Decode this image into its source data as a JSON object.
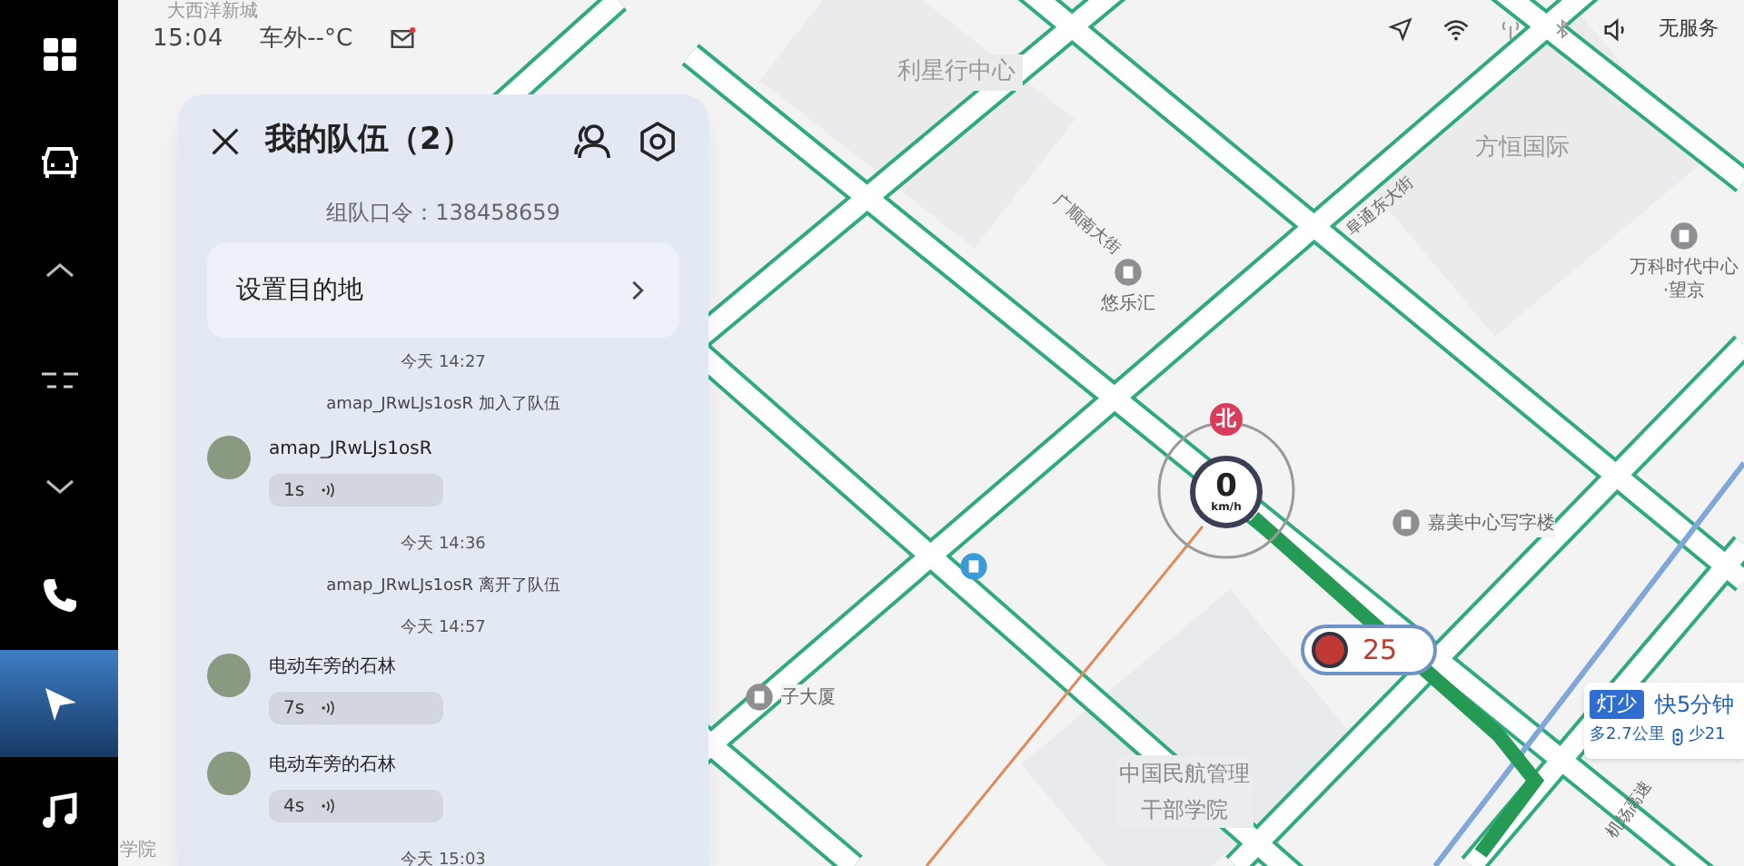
{
  "status_bar": {
    "time": "15:04",
    "outside_temp": "车外--°C",
    "network": "无服务"
  },
  "sidebar": {
    "items": [
      {
        "kind": "apps",
        "selected": false
      },
      {
        "kind": "car",
        "selected": false
      },
      {
        "kind": "up",
        "selected": false
      },
      {
        "kind": "split",
        "selected": false
      },
      {
        "kind": "down",
        "selected": false
      },
      {
        "kind": "phone",
        "selected": false
      },
      {
        "kind": "nav",
        "selected": true
      },
      {
        "kind": "music",
        "selected": false
      }
    ]
  },
  "team_panel": {
    "title": "我的队伍（2）",
    "team_code": "组队口令：138458659",
    "destination": "设置目的地",
    "messages": [
      {
        "kind": "time",
        "text": "今天 14:27"
      },
      {
        "kind": "notice",
        "text": "amap_JRwLJs1osR 加入了队伍"
      },
      {
        "kind": "voice",
        "sender": "amap_JRwLJs1osR",
        "duration": "1s"
      },
      {
        "kind": "time",
        "text": "今天 14:36"
      },
      {
        "kind": "notice",
        "text": "amap_JRwLJs1osR 离开了队伍"
      },
      {
        "kind": "time",
        "text": "今天 14:57"
      },
      {
        "kind": "voice",
        "sender": "电动车旁的石林",
        "duration": "7s"
      },
      {
        "kind": "voice",
        "sender": "电动车旁的石林",
        "duration": "4s"
      },
      {
        "kind": "time",
        "text": "今天 15:03"
      }
    ]
  },
  "map": {
    "places": [
      {
        "kind": "area",
        "text": "利星行中心"
      },
      {
        "kind": "area",
        "text": "方恒国际"
      },
      {
        "kind": "poi",
        "text": "悠乐汇"
      },
      {
        "kind": "poi",
        "text": "万科时代中心·望京"
      },
      {
        "kind": "poi",
        "text": "嘉美中心写字楼"
      },
      {
        "kind": "area",
        "text": "中国民航管理干部学院"
      },
      {
        "kind": "poi",
        "text": "子大厦"
      },
      {
        "kind": "area",
        "text": "大西洋新城"
      },
      {
        "kind": "area",
        "text": "学院"
      }
    ],
    "roads": [
      "广顺南大街",
      "阜通东大街",
      "机场高速"
    ],
    "compass": "北",
    "speed": "0",
    "speed_unit": "km/h",
    "traffic_light": "25",
    "route_card": {
      "tag": "灯少",
      "gain": "快5分钟",
      "distance": "多2.7公里",
      "lights": "少21"
    }
  }
}
